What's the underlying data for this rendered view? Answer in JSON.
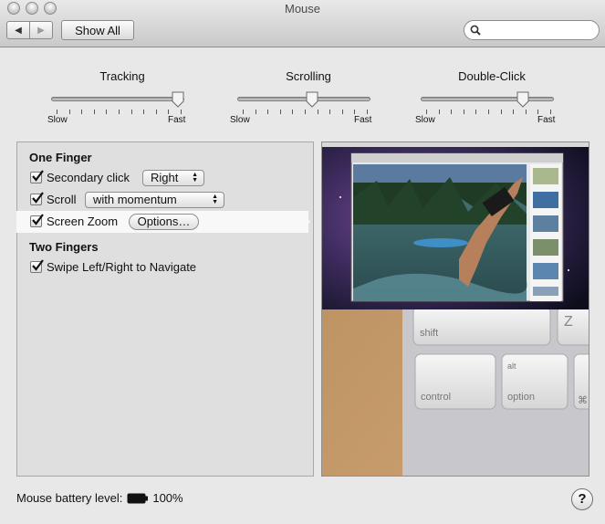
{
  "window": {
    "title": "Mouse"
  },
  "toolbar": {
    "back_glyph": "◀",
    "forward_glyph": "▶",
    "show_all_label": "Show All",
    "search_placeholder": ""
  },
  "sliders": [
    {
      "title": "Tracking",
      "min_label": "Slow",
      "max_label": "Fast",
      "value_fraction": 0.95
    },
    {
      "title": "Scrolling",
      "min_label": "Slow",
      "max_label": "Fast",
      "value_fraction": 0.56
    },
    {
      "title": "Double-Click",
      "min_label": "Slow",
      "max_label": "Fast",
      "value_fraction": 0.77
    }
  ],
  "gestures": {
    "one_finger_header": "One Finger",
    "secondary_click": {
      "label": "Secondary click",
      "checked": true,
      "option": "Right"
    },
    "scroll": {
      "label": "Scroll",
      "checked": true,
      "option": "with momentum"
    },
    "screen_zoom": {
      "label": "Screen Zoom",
      "checked": true,
      "button": "Options…"
    },
    "two_fingers_header": "Two Fingers",
    "swipe": {
      "label": "Swipe Left/Right to Navigate",
      "checked": true
    }
  },
  "preview": {
    "keys": {
      "shift": "shift",
      "z": "Z",
      "alt": "alt",
      "option": "option",
      "control": "control",
      "cmd_glyph": "⌘"
    }
  },
  "footer": {
    "battery_label": "Mouse battery level:",
    "battery_value": "100%",
    "help_glyph": "?"
  }
}
